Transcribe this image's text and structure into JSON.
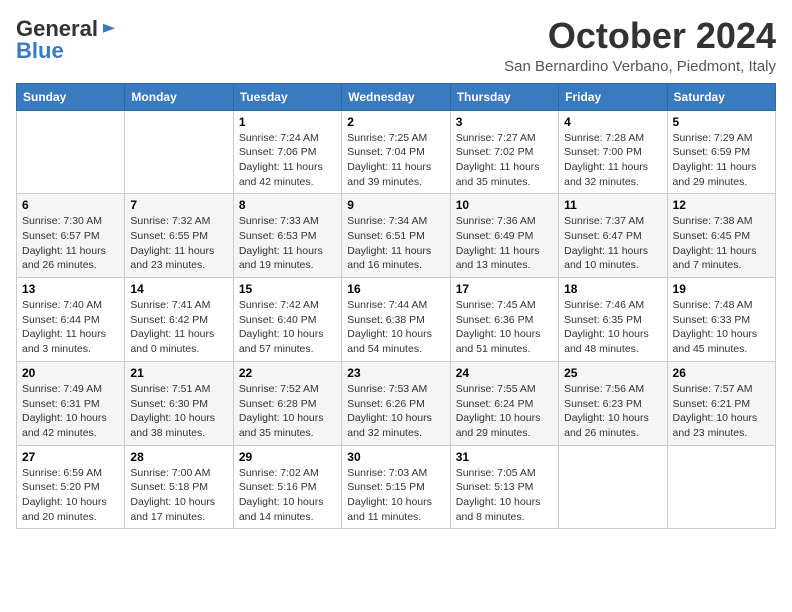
{
  "logo": {
    "general": "General",
    "blue": "Blue"
  },
  "header": {
    "month": "October 2024",
    "location": "San Bernardino Verbano, Piedmont, Italy"
  },
  "days_of_week": [
    "Sunday",
    "Monday",
    "Tuesday",
    "Wednesday",
    "Thursday",
    "Friday",
    "Saturday"
  ],
  "weeks": [
    [
      {
        "day": "",
        "info": ""
      },
      {
        "day": "",
        "info": ""
      },
      {
        "day": "1",
        "info": "Sunrise: 7:24 AM\nSunset: 7:06 PM\nDaylight: 11 hours and 42 minutes."
      },
      {
        "day": "2",
        "info": "Sunrise: 7:25 AM\nSunset: 7:04 PM\nDaylight: 11 hours and 39 minutes."
      },
      {
        "day": "3",
        "info": "Sunrise: 7:27 AM\nSunset: 7:02 PM\nDaylight: 11 hours and 35 minutes."
      },
      {
        "day": "4",
        "info": "Sunrise: 7:28 AM\nSunset: 7:00 PM\nDaylight: 11 hours and 32 minutes."
      },
      {
        "day": "5",
        "info": "Sunrise: 7:29 AM\nSunset: 6:59 PM\nDaylight: 11 hours and 29 minutes."
      }
    ],
    [
      {
        "day": "6",
        "info": "Sunrise: 7:30 AM\nSunset: 6:57 PM\nDaylight: 11 hours and 26 minutes."
      },
      {
        "day": "7",
        "info": "Sunrise: 7:32 AM\nSunset: 6:55 PM\nDaylight: 11 hours and 23 minutes."
      },
      {
        "day": "8",
        "info": "Sunrise: 7:33 AM\nSunset: 6:53 PM\nDaylight: 11 hours and 19 minutes."
      },
      {
        "day": "9",
        "info": "Sunrise: 7:34 AM\nSunset: 6:51 PM\nDaylight: 11 hours and 16 minutes."
      },
      {
        "day": "10",
        "info": "Sunrise: 7:36 AM\nSunset: 6:49 PM\nDaylight: 11 hours and 13 minutes."
      },
      {
        "day": "11",
        "info": "Sunrise: 7:37 AM\nSunset: 6:47 PM\nDaylight: 11 hours and 10 minutes."
      },
      {
        "day": "12",
        "info": "Sunrise: 7:38 AM\nSunset: 6:45 PM\nDaylight: 11 hours and 7 minutes."
      }
    ],
    [
      {
        "day": "13",
        "info": "Sunrise: 7:40 AM\nSunset: 6:44 PM\nDaylight: 11 hours and 3 minutes."
      },
      {
        "day": "14",
        "info": "Sunrise: 7:41 AM\nSunset: 6:42 PM\nDaylight: 11 hours and 0 minutes."
      },
      {
        "day": "15",
        "info": "Sunrise: 7:42 AM\nSunset: 6:40 PM\nDaylight: 10 hours and 57 minutes."
      },
      {
        "day": "16",
        "info": "Sunrise: 7:44 AM\nSunset: 6:38 PM\nDaylight: 10 hours and 54 minutes."
      },
      {
        "day": "17",
        "info": "Sunrise: 7:45 AM\nSunset: 6:36 PM\nDaylight: 10 hours and 51 minutes."
      },
      {
        "day": "18",
        "info": "Sunrise: 7:46 AM\nSunset: 6:35 PM\nDaylight: 10 hours and 48 minutes."
      },
      {
        "day": "19",
        "info": "Sunrise: 7:48 AM\nSunset: 6:33 PM\nDaylight: 10 hours and 45 minutes."
      }
    ],
    [
      {
        "day": "20",
        "info": "Sunrise: 7:49 AM\nSunset: 6:31 PM\nDaylight: 10 hours and 42 minutes."
      },
      {
        "day": "21",
        "info": "Sunrise: 7:51 AM\nSunset: 6:30 PM\nDaylight: 10 hours and 38 minutes."
      },
      {
        "day": "22",
        "info": "Sunrise: 7:52 AM\nSunset: 6:28 PM\nDaylight: 10 hours and 35 minutes."
      },
      {
        "day": "23",
        "info": "Sunrise: 7:53 AM\nSunset: 6:26 PM\nDaylight: 10 hours and 32 minutes."
      },
      {
        "day": "24",
        "info": "Sunrise: 7:55 AM\nSunset: 6:24 PM\nDaylight: 10 hours and 29 minutes."
      },
      {
        "day": "25",
        "info": "Sunrise: 7:56 AM\nSunset: 6:23 PM\nDaylight: 10 hours and 26 minutes."
      },
      {
        "day": "26",
        "info": "Sunrise: 7:57 AM\nSunset: 6:21 PM\nDaylight: 10 hours and 23 minutes."
      }
    ],
    [
      {
        "day": "27",
        "info": "Sunrise: 6:59 AM\nSunset: 5:20 PM\nDaylight: 10 hours and 20 minutes."
      },
      {
        "day": "28",
        "info": "Sunrise: 7:00 AM\nSunset: 5:18 PM\nDaylight: 10 hours and 17 minutes."
      },
      {
        "day": "29",
        "info": "Sunrise: 7:02 AM\nSunset: 5:16 PM\nDaylight: 10 hours and 14 minutes."
      },
      {
        "day": "30",
        "info": "Sunrise: 7:03 AM\nSunset: 5:15 PM\nDaylight: 10 hours and 11 minutes."
      },
      {
        "day": "31",
        "info": "Sunrise: 7:05 AM\nSunset: 5:13 PM\nDaylight: 10 hours and 8 minutes."
      },
      {
        "day": "",
        "info": ""
      },
      {
        "day": "",
        "info": ""
      }
    ]
  ]
}
